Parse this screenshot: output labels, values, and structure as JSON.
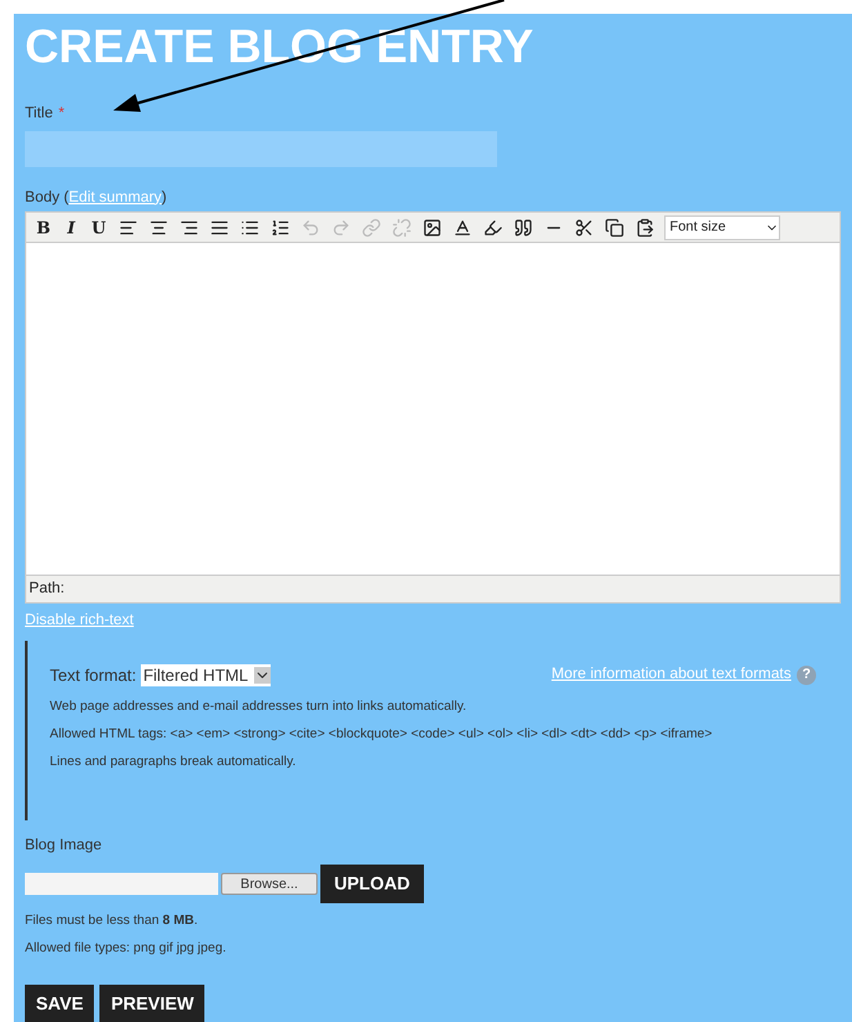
{
  "heading": "CREATE BLOG ENTRY",
  "title_field": {
    "label": "Title",
    "required_mark": "*"
  },
  "body": {
    "label_before": "Body (",
    "summary_link": "Edit summary",
    "label_after": ")",
    "toolbar": [
      {
        "kind": "text",
        "label": "B",
        "disabled": false
      },
      {
        "kind": "text",
        "label": "I",
        "disabled": false
      },
      {
        "kind": "text",
        "label": "U",
        "disabled": false
      },
      {
        "kind": "icon",
        "disabled": false
      },
      {
        "kind": "icon",
        "disabled": false
      },
      {
        "kind": "icon",
        "disabled": false
      },
      {
        "kind": "icon",
        "disabled": false
      },
      {
        "kind": "icon",
        "disabled": false
      },
      {
        "kind": "icon",
        "disabled": false
      },
      {
        "kind": "icon",
        "disabled": true
      },
      {
        "kind": "icon",
        "disabled": true
      },
      {
        "kind": "icon",
        "disabled": true
      },
      {
        "kind": "icon",
        "disabled": true
      },
      {
        "kind": "icon",
        "disabled": false
      },
      {
        "kind": "icon",
        "disabled": false
      },
      {
        "kind": "icon",
        "disabled": false
      },
      {
        "kind": "icon",
        "disabled": false
      },
      {
        "kind": "icon",
        "disabled": false
      },
      {
        "kind": "icon",
        "disabled": false
      },
      {
        "kind": "icon",
        "disabled": false
      },
      {
        "kind": "icon",
        "disabled": false
      }
    ],
    "font_size": "Font size",
    "path": "Path:"
  },
  "disable_link": "Disable rich-text",
  "text_format": {
    "label": "Text format:",
    "value": "Filtered HTML",
    "more_link": "More information about text formats",
    "help": "?",
    "tips": [
      "Web page addresses and e-mail addresses turn into links automatically.",
      "Allowed HTML tags: <a> <em> <strong> <cite> <blockquote> <code> <ul> <ol> <li> <dl> <dt> <dd> <p> <iframe>",
      "Lines and paragraphs break automatically."
    ]
  },
  "blog_image": {
    "label": "Blog Image",
    "browse": "Browse...",
    "upload": "UPLOAD",
    "notes": [
      "Files must be less than **8 MB**.",
      "Allowed file types: png gif jpg jpeg."
    ]
  },
  "buttons": [
    "SAVE",
    "PREVIEW"
  ]
}
